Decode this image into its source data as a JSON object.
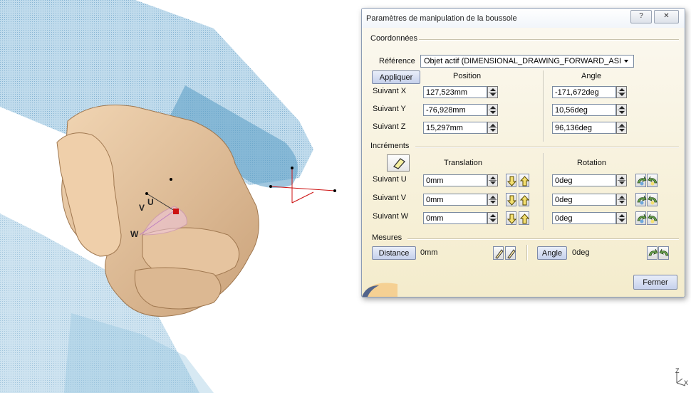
{
  "dialog": {
    "title": "Paramètres de manipulation de la boussole",
    "help_glyph": "?",
    "close_glyph": "✕",
    "coordonnees": {
      "section_label": "Coordonnées",
      "reference_label": "Référence",
      "reference_value": "Objet actif (DIMENSIONAL_DRAWING_FORWARD_ASI",
      "apply_label": "Appliquer",
      "position_header": "Position",
      "angle_header": "Angle",
      "rows": [
        {
          "label": "Suivant X",
          "position": "127,523mm",
          "angle": "-171,672deg"
        },
        {
          "label": "Suivant Y",
          "position": "-76,928mm",
          "angle": "10,56deg"
        },
        {
          "label": "Suivant Z",
          "position": "15,297mm",
          "angle": "96,136deg"
        }
      ]
    },
    "increments": {
      "section_label": "Incréments",
      "translation_header": "Translation",
      "rotation_header": "Rotation",
      "rows": [
        {
          "label": "Suivant U",
          "translation": "0mm",
          "rotation": "0deg"
        },
        {
          "label": "Suivant V",
          "translation": "0mm",
          "rotation": "0deg"
        },
        {
          "label": "Suivant W",
          "translation": "0mm",
          "rotation": "0deg"
        }
      ]
    },
    "mesures": {
      "section_label": "Mesures",
      "distance_label": "Distance",
      "distance_value": "0mm",
      "angle_label": "Angle",
      "angle_value": "0deg"
    },
    "close_label": "Fermer"
  },
  "viewport": {
    "compass_labels": {
      "u": "U",
      "v": "V",
      "w": "W"
    },
    "axis_labels": {
      "z": "Z",
      "x": "X"
    }
  },
  "colors": {
    "arm": "#6aa6cc",
    "hand": "#e4c29c",
    "dialog_bg": "#f7f1df",
    "compass_red": "#cc1111"
  }
}
